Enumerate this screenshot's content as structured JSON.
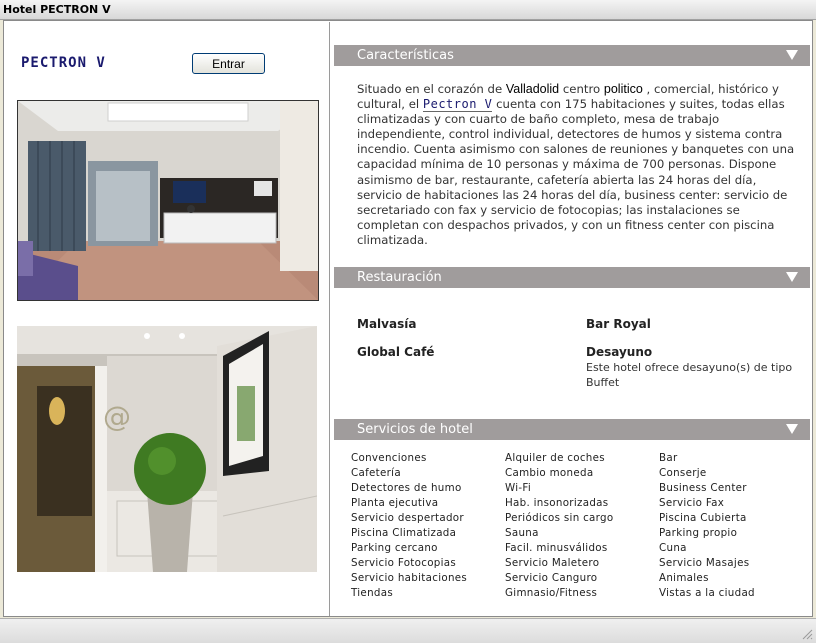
{
  "window": {
    "title": "Hotel PECTRON V"
  },
  "header": {
    "brand": "PECTRON V",
    "enter_button": "Entrar"
  },
  "sections": {
    "features": {
      "title": "Características",
      "text_1": "Situado en el corazón de ",
      "city": "Valladolid",
      "text_2": " centro ",
      "politico": "politico",
      "text_3": " , comercial, histórico y cultural, el ",
      "hotel_name": "Pectron V",
      "text_4": " cuenta con 175 habitaciones y suites, todas ellas climatizadas y con cuarto de baño completo, mesa de trabajo independiente, control individual, detectores de humos y sistema contra incendio. Cuenta asimismo con salones de reuniones y banquetes con una capacidad mínima de 10 personas y máxima de 700 personas. Dispone asimismo de bar, restaurante, cafetería abierta las 24 horas del día, servicio de habitaciones las 24 horas del día, business center: servicio de secretariado con fax y servicio de fotocopias; las instalaciones se completan con despachos privados, y con un fitness center con piscina climatizada."
    },
    "dining": {
      "title": "Restauración",
      "items": [
        "Malvasía",
        "Bar Royal",
        "Global Café",
        "Desayuno"
      ],
      "breakfast_note": "Este hotel ofrece desayuno(s) de tipo Buffet"
    },
    "services": {
      "title": "Servicios de hotel",
      "col1": [
        "Convenciones",
        "Cafetería",
        "Detectores de humo",
        "Planta ejecutiva",
        "Servicio despertador",
        "Piscina Climatizada",
        "Parking cercano",
        "Servicio Fotocopias",
        "Servicio habitaciones",
        "Tiendas"
      ],
      "col2": [
        "Alquiler de coches",
        "Cambio moneda",
        "Wi-Fi",
        "Hab. insonorizadas",
        "Periódicos sin cargo",
        "Sauna",
        "Facil. minusválidos",
        "Servicio Maletero",
        "Servicio Canguro",
        "Gimnasio/Fitness"
      ],
      "col3": [
        "Bar",
        "Conserje",
        "Business Center",
        "Servicio Fax",
        "Piscina Cubierta",
        "Parking propio",
        "Cuna",
        "Servicio Masajes",
        "Animales",
        "Vistas a la ciudad"
      ]
    }
  },
  "icons": {
    "collapse": "chevron-down-icon",
    "resize": "resize-grip-icon"
  },
  "colors": {
    "section_bar": "#a09c9c",
    "brand": "#1a1a6e"
  }
}
